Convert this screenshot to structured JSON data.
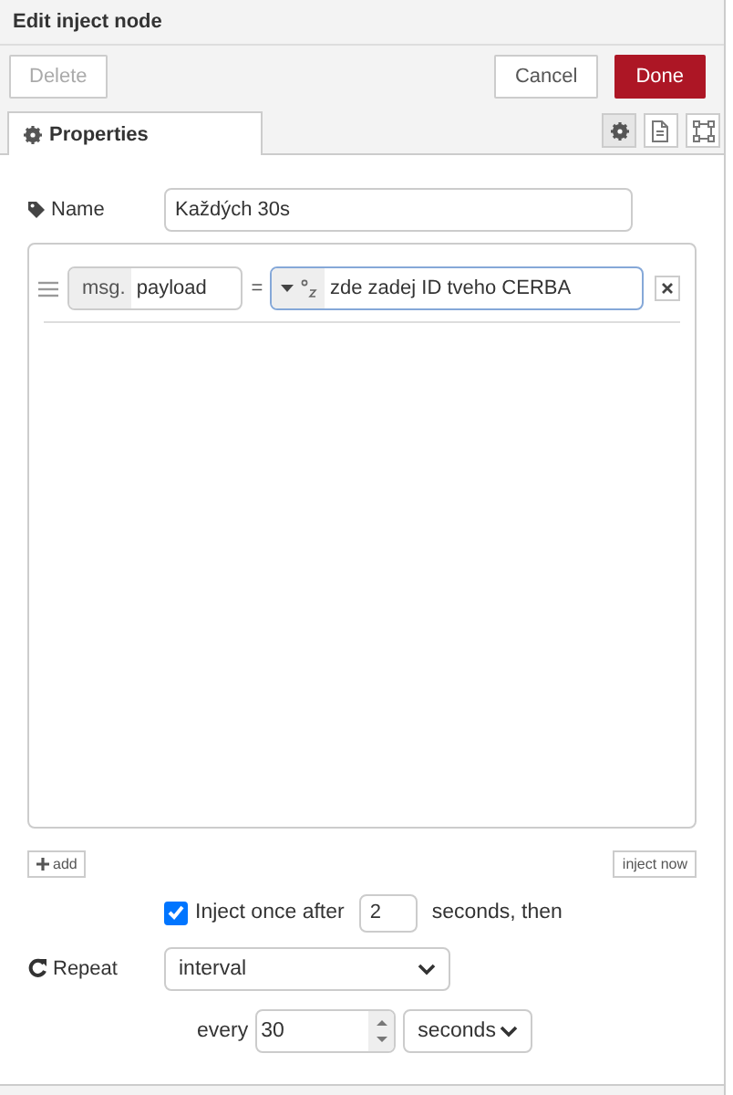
{
  "window": {
    "title": "Edit inject node"
  },
  "buttons": [
    {
      "label": "Delete",
      "kind": "plain",
      "disabled": true
    },
    {
      "label": "Cancel",
      "kind": "plain",
      "disabled": false
    },
    {
      "label": "Done",
      "kind": "primary",
      "disabled": false
    }
  ],
  "tabs": [
    {
      "label": "Properties",
      "selected": true
    }
  ],
  "tab_icons": [
    {
      "kind": "gear",
      "selected": true
    },
    {
      "kind": "document",
      "selected": false
    },
    {
      "kind": "frame",
      "selected": false
    }
  ],
  "name": {
    "label": "Name",
    "value": "Každých 30s"
  },
  "properties": [
    {
      "prefix": "msg.",
      "key": "payload",
      "operator": "=",
      "value": "zde zadej ID tveho CERBA"
    }
  ],
  "add_button": "add",
  "inject_now_button": "inject now",
  "inject_once": {
    "checked": true,
    "label": "Inject once after",
    "value": "2",
    "suffix": "seconds, then"
  },
  "repeat": {
    "label": "Repeat",
    "mode": "interval",
    "every_label": "every",
    "every": "30",
    "unit": "seconds"
  }
}
